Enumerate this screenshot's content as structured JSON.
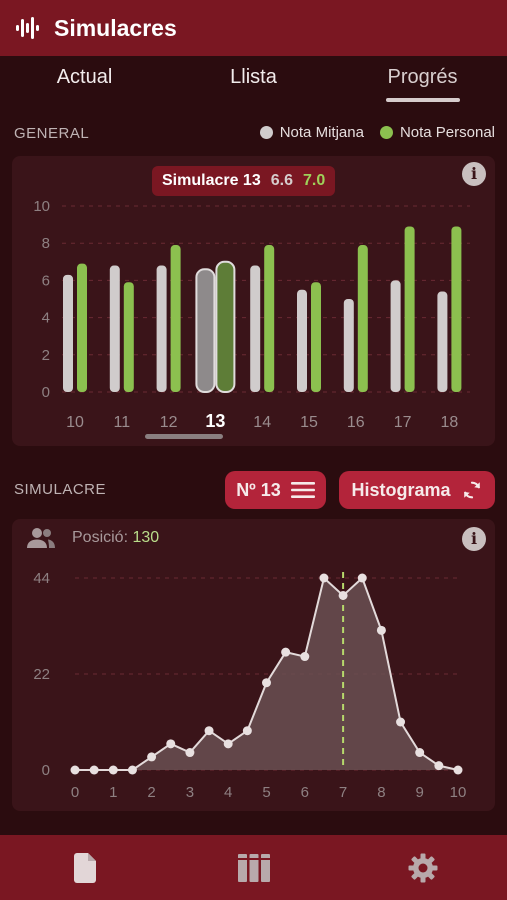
{
  "app": {
    "title": "Simulacres",
    "logo_icon": "waveform-icon"
  },
  "tabs": [
    {
      "label": "Actual",
      "active": false
    },
    {
      "label": "Llista",
      "active": false
    },
    {
      "label": "Progrés",
      "active": true
    }
  ],
  "general": {
    "section_label": "GENERAL",
    "legend": [
      {
        "label": "Nota Mitjana",
        "color": "#d0cccc"
      },
      {
        "label": "Nota Personal",
        "color": "#8cc04f"
      }
    ],
    "tooltip": {
      "label": "Simulacre 13",
      "average": "6.6",
      "personal": "7.0"
    },
    "info_icon": "info-icon"
  },
  "simulacre": {
    "section_label": "SIMULACRE",
    "number_button": {
      "label": "Nº 13",
      "icon": "menu-icon"
    },
    "mode_button": {
      "label": "Histograma",
      "icon": "refresh-icon"
    },
    "position": {
      "label": "Posició:",
      "value": "130",
      "icon": "people-icon"
    }
  },
  "bottom_nav": [
    {
      "icon": "document-icon"
    },
    {
      "icon": "library-icon"
    },
    {
      "icon": "settings-icon"
    }
  ],
  "colors": {
    "primary": "#7a1722",
    "background": "#2b0c0f",
    "card": "#3a1419",
    "average_bar": "#d0cccc",
    "personal_bar": "#8cc04f",
    "accent_button": "#b3243a"
  },
  "chart_data": [
    {
      "type": "bar",
      "categories": [
        "10",
        "11",
        "12",
        "13",
        "14",
        "15",
        "16",
        "17",
        "18"
      ],
      "selected": "13",
      "series": [
        {
          "name": "Nota Mitjana",
          "values": [
            6.3,
            6.8,
            6.8,
            6.6,
            6.8,
            5.5,
            5.0,
            6.0,
            5.4
          ]
        },
        {
          "name": "Nota Personal",
          "values": [
            6.9,
            5.9,
            7.9,
            7.0,
            7.9,
            5.9,
            7.9,
            8.9,
            8.9
          ]
        }
      ],
      "yticks": [
        "0",
        "2",
        "4",
        "6",
        "8",
        "10"
      ],
      "ylim": [
        0,
        10
      ],
      "grid": true
    },
    {
      "type": "area",
      "x": [
        0,
        0.5,
        1,
        1.5,
        2,
        2.5,
        3,
        3.5,
        4,
        4.5,
        5,
        5.5,
        6,
        6.5,
        7,
        7.5,
        8,
        8.5,
        9,
        9.5,
        10
      ],
      "y": [
        0,
        0,
        0,
        0,
        3,
        6,
        4,
        9,
        6,
        9,
        20,
        27,
        26,
        44,
        40,
        44,
        32,
        11,
        4,
        1,
        0
      ],
      "xticks": [
        "0",
        "1",
        "2",
        "3",
        "4",
        "5",
        "6",
        "7",
        "8",
        "9",
        "10"
      ],
      "yticks": [
        "0",
        "22",
        "44"
      ],
      "ylim": [
        0,
        44
      ],
      "marker_x": 7,
      "grid": true
    }
  ]
}
